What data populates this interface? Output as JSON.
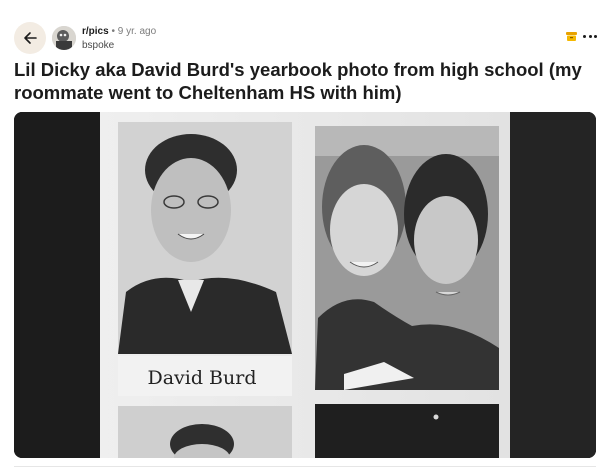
{
  "header": {
    "subreddit": "r/pics",
    "separator": "•",
    "age": "9 yr. ago",
    "author": "bspoke"
  },
  "post": {
    "title": "Lil Dicky aka David Burd's yearbook photo from high school (my roommate went to Cheltenham HS with him)"
  },
  "media": {
    "caption": "David Burd"
  },
  "icons": {
    "back": "back-arrow-icon",
    "award": "award-icon",
    "more": "more-options-icon"
  }
}
